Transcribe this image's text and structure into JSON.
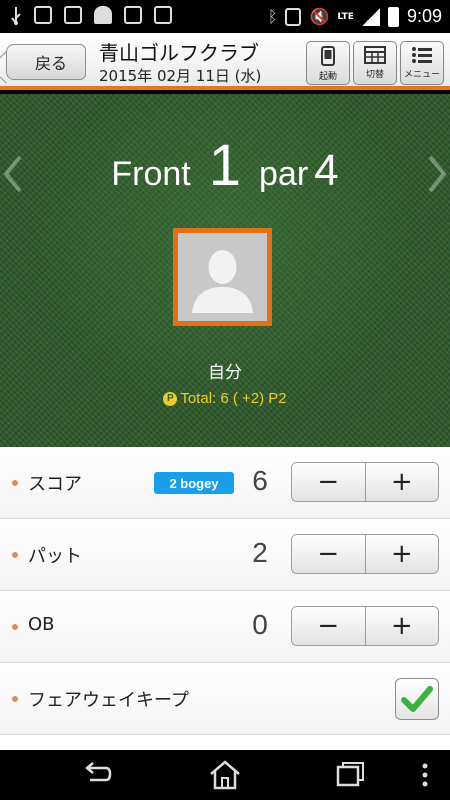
{
  "status_bar": {
    "time": "9:09",
    "network": "LTE"
  },
  "header": {
    "back_label": "戻る",
    "course_name": "青山ゴルフクラブ",
    "date": "2015年 02月 11日 (水)",
    "buttons": [
      {
        "icon": "phone-icon",
        "label": "起動"
      },
      {
        "icon": "table-icon",
        "label": "切替"
      },
      {
        "icon": "menu-icon",
        "label": "メニュー"
      }
    ]
  },
  "hole": {
    "prefix": "Front",
    "number": "1",
    "par_label": "par",
    "par": "4"
  },
  "player": {
    "name": "自分",
    "total": "Total: 6 ( +2) P2"
  },
  "rows": {
    "score": {
      "label": "スコア",
      "badge": "2 bogey",
      "value": "6",
      "minus": "−",
      "plus": "+"
    },
    "putt": {
      "label": "パット",
      "value": "2",
      "minus": "−",
      "plus": "+"
    },
    "ob": {
      "label": "OB",
      "value": "0",
      "minus": "−",
      "plus": "+"
    },
    "fairway": {
      "label": "フェアウェイキープ",
      "checked": true
    }
  },
  "colors": {
    "accent": "#e8761f",
    "badge": "#1a9ee8",
    "total": "#f0cc25",
    "check": "#3cb043"
  }
}
